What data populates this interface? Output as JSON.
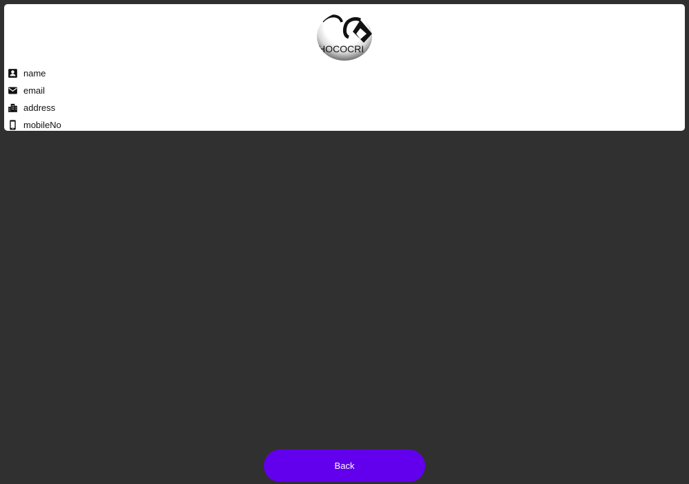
{
  "profile": {
    "logo_text": "HOCOCRI",
    "rows": [
      {
        "icon": "contact-card-icon",
        "label": "name"
      },
      {
        "icon": "mail-icon",
        "label": "email"
      },
      {
        "icon": "city-icon",
        "label": "address"
      },
      {
        "icon": "mobile-phone-icon",
        "label": "mobileNo"
      }
    ]
  },
  "actions": {
    "back_label": "Back"
  },
  "colors": {
    "background": "#303030",
    "card": "#ffffff",
    "accent": "#6200ee",
    "button_text": "#ffffff"
  }
}
